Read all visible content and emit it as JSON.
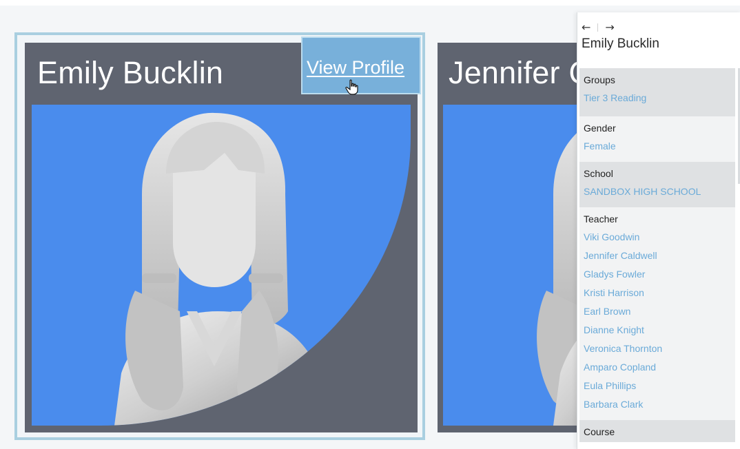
{
  "cards": [
    {
      "name": "Emily Bucklin",
      "view_profile_label": "View Profile",
      "photo_background": "#4a8ced"
    },
    {
      "name": "Jennifer C",
      "photo_background": "#4a8ced"
    }
  ],
  "panel": {
    "back_icon": "arrow-left-icon",
    "forward_icon": "arrow-right-icon",
    "back_glyph": "←",
    "forward_glyph": "→",
    "title": "Emily Bucklin",
    "sections": {
      "groups": {
        "heading": "Groups",
        "items": [
          "Tier 3 Reading"
        ]
      },
      "gender": {
        "heading": "Gender",
        "items": [
          "Female"
        ]
      },
      "school": {
        "heading": "School",
        "items": [
          "SANDBOX HIGH SCHOOL"
        ]
      },
      "teacher": {
        "heading": "Teacher",
        "items": [
          "Viki Goodwin",
          "Jennifer Caldwell",
          "Gladys Fowler",
          "Kristi Harrison",
          "Earl Brown",
          "Dianne Knight",
          "Veronica Thornton",
          "Amparo Copland",
          "Eula Phillips",
          "Barbara Clark"
        ]
      },
      "course": {
        "heading": "Course",
        "items": []
      }
    }
  },
  "colors": {
    "card_header": "#5f6470",
    "card_selected_border": "#a9cfe0",
    "view_profile_bg": "#78b0da",
    "link": "#6aaad8"
  }
}
